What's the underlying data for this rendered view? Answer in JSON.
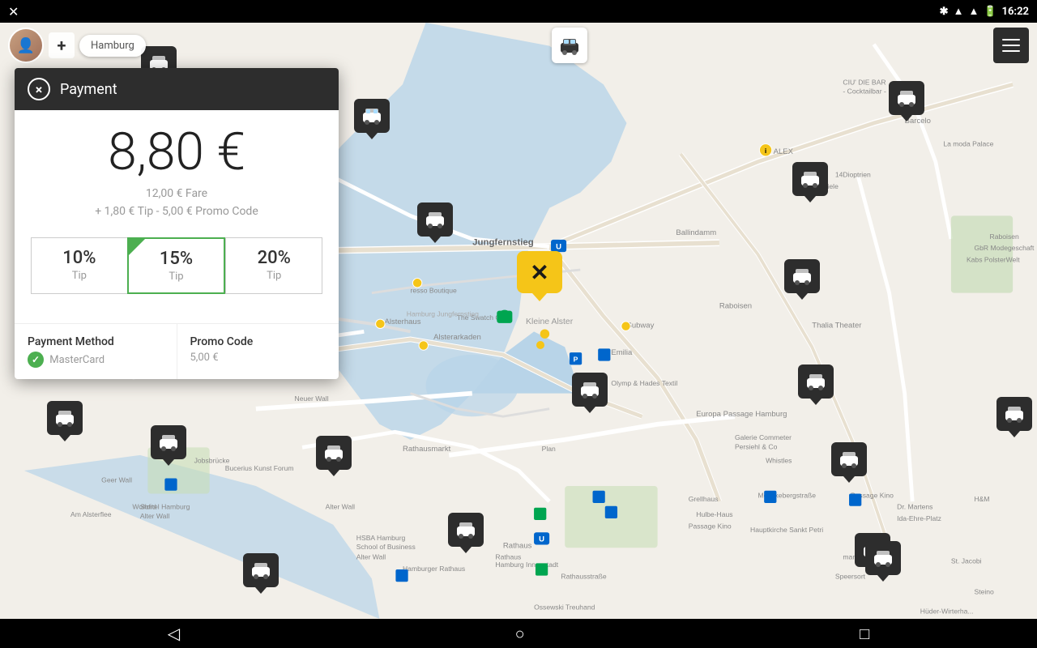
{
  "statusBar": {
    "leftIcon": "×",
    "bluetooth": "bluetooth",
    "signal": "signal",
    "wifi": "wifi",
    "battery": "battery",
    "time": "16:22"
  },
  "topBar": {
    "locationLabel": "Hamburg",
    "addLabel": "+",
    "menuLines": 3
  },
  "payment": {
    "title": "Payment",
    "closeLabel": "×",
    "mainPrice": "8,80 €",
    "fareLabel": "12,00 € Fare",
    "tipPromoLabel": "+ 1,80 € Tip - 5,00 € Promo Code",
    "tips": [
      {
        "percent": "10%",
        "label": "Tip",
        "selected": false
      },
      {
        "percent": "15%",
        "label": "Tip",
        "selected": true
      },
      {
        "percent": "20%",
        "label": "Tip",
        "selected": false
      }
    ],
    "paymentMethodLabel": "Payment Method",
    "paymentMethodValue": "MasterCard",
    "promoCodeLabel": "Promo Code",
    "promoCodeValue": "5,00 €"
  },
  "nav": {
    "back": "◁",
    "home": "○",
    "recent": "□"
  },
  "taxiMarkers": [
    {
      "id": "t1",
      "top": "122",
      "left": "437"
    },
    {
      "id": "t2",
      "top": "57",
      "left": "174"
    },
    {
      "id": "t3",
      "top": "200",
      "left": "978"
    },
    {
      "id": "t4",
      "top": "216",
      "left": "1117"
    },
    {
      "id": "t5",
      "top": "310",
      "left": "522"
    },
    {
      "id": "t6",
      "top": "330",
      "left": "975"
    },
    {
      "id": "t7",
      "top": "465",
      "left": "710"
    },
    {
      "id": "t8",
      "top": "460",
      "left": "990"
    },
    {
      "id": "t9",
      "top": "510",
      "left": "1240"
    },
    {
      "id": "t10",
      "top": "533",
      "left": "192"
    },
    {
      "id": "t11",
      "top": "510",
      "left": "62"
    },
    {
      "id": "t12",
      "top": "548",
      "left": "395"
    },
    {
      "id": "t13",
      "top": "554",
      "left": "1038"
    },
    {
      "id": "t14",
      "top": "630",
      "left": "558"
    },
    {
      "id": "t15",
      "top": "660",
      "left": "1080"
    },
    {
      "id": "t16",
      "top": "695",
      "left": "304"
    },
    {
      "id": "t17",
      "top": "670",
      "left": "1083"
    }
  ],
  "logoMarker": {
    "top": "305",
    "left": "640"
  }
}
